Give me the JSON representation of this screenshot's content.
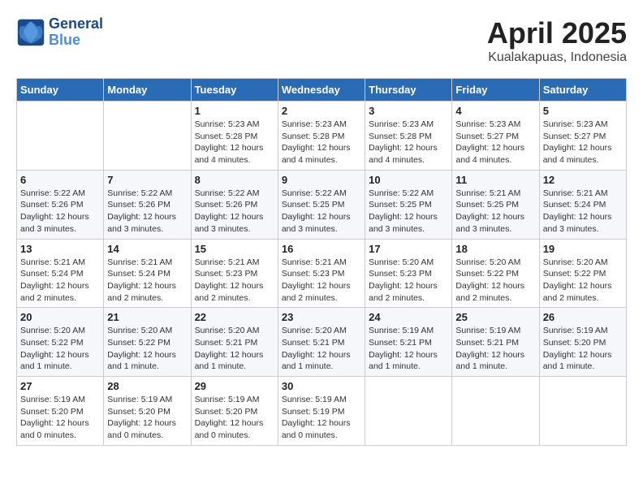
{
  "header": {
    "logo_line1": "General",
    "logo_line2": "Blue",
    "month_year": "April 2025",
    "location": "Kualakapuas, Indonesia"
  },
  "columns": [
    "Sunday",
    "Monday",
    "Tuesday",
    "Wednesday",
    "Thursday",
    "Friday",
    "Saturday"
  ],
  "weeks": [
    [
      {
        "day": "",
        "info": ""
      },
      {
        "day": "",
        "info": ""
      },
      {
        "day": "1",
        "info": "Sunrise: 5:23 AM\nSunset: 5:28 PM\nDaylight: 12 hours\nand 4 minutes."
      },
      {
        "day": "2",
        "info": "Sunrise: 5:23 AM\nSunset: 5:28 PM\nDaylight: 12 hours\nand 4 minutes."
      },
      {
        "day": "3",
        "info": "Sunrise: 5:23 AM\nSunset: 5:28 PM\nDaylight: 12 hours\nand 4 minutes."
      },
      {
        "day": "4",
        "info": "Sunrise: 5:23 AM\nSunset: 5:27 PM\nDaylight: 12 hours\nand 4 minutes."
      },
      {
        "day": "5",
        "info": "Sunrise: 5:23 AM\nSunset: 5:27 PM\nDaylight: 12 hours\nand 4 minutes."
      }
    ],
    [
      {
        "day": "6",
        "info": "Sunrise: 5:22 AM\nSunset: 5:26 PM\nDaylight: 12 hours\nand 3 minutes."
      },
      {
        "day": "7",
        "info": "Sunrise: 5:22 AM\nSunset: 5:26 PM\nDaylight: 12 hours\nand 3 minutes."
      },
      {
        "day": "8",
        "info": "Sunrise: 5:22 AM\nSunset: 5:26 PM\nDaylight: 12 hours\nand 3 minutes."
      },
      {
        "day": "9",
        "info": "Sunrise: 5:22 AM\nSunset: 5:25 PM\nDaylight: 12 hours\nand 3 minutes."
      },
      {
        "day": "10",
        "info": "Sunrise: 5:22 AM\nSunset: 5:25 PM\nDaylight: 12 hours\nand 3 minutes."
      },
      {
        "day": "11",
        "info": "Sunrise: 5:21 AM\nSunset: 5:25 PM\nDaylight: 12 hours\nand 3 minutes."
      },
      {
        "day": "12",
        "info": "Sunrise: 5:21 AM\nSunset: 5:24 PM\nDaylight: 12 hours\nand 3 minutes."
      }
    ],
    [
      {
        "day": "13",
        "info": "Sunrise: 5:21 AM\nSunset: 5:24 PM\nDaylight: 12 hours\nand 2 minutes."
      },
      {
        "day": "14",
        "info": "Sunrise: 5:21 AM\nSunset: 5:24 PM\nDaylight: 12 hours\nand 2 minutes."
      },
      {
        "day": "15",
        "info": "Sunrise: 5:21 AM\nSunset: 5:23 PM\nDaylight: 12 hours\nand 2 minutes."
      },
      {
        "day": "16",
        "info": "Sunrise: 5:21 AM\nSunset: 5:23 PM\nDaylight: 12 hours\nand 2 minutes."
      },
      {
        "day": "17",
        "info": "Sunrise: 5:20 AM\nSunset: 5:23 PM\nDaylight: 12 hours\nand 2 minutes."
      },
      {
        "day": "18",
        "info": "Sunrise: 5:20 AM\nSunset: 5:22 PM\nDaylight: 12 hours\nand 2 minutes."
      },
      {
        "day": "19",
        "info": "Sunrise: 5:20 AM\nSunset: 5:22 PM\nDaylight: 12 hours\nand 2 minutes."
      }
    ],
    [
      {
        "day": "20",
        "info": "Sunrise: 5:20 AM\nSunset: 5:22 PM\nDaylight: 12 hours\nand 1 minute."
      },
      {
        "day": "21",
        "info": "Sunrise: 5:20 AM\nSunset: 5:22 PM\nDaylight: 12 hours\nand 1 minute."
      },
      {
        "day": "22",
        "info": "Sunrise: 5:20 AM\nSunset: 5:21 PM\nDaylight: 12 hours\nand 1 minute."
      },
      {
        "day": "23",
        "info": "Sunrise: 5:20 AM\nSunset: 5:21 PM\nDaylight: 12 hours\nand 1 minute."
      },
      {
        "day": "24",
        "info": "Sunrise: 5:19 AM\nSunset: 5:21 PM\nDaylight: 12 hours\nand 1 minute."
      },
      {
        "day": "25",
        "info": "Sunrise: 5:19 AM\nSunset: 5:21 PM\nDaylight: 12 hours\nand 1 minute."
      },
      {
        "day": "26",
        "info": "Sunrise: 5:19 AM\nSunset: 5:20 PM\nDaylight: 12 hours\nand 1 minute."
      }
    ],
    [
      {
        "day": "27",
        "info": "Sunrise: 5:19 AM\nSunset: 5:20 PM\nDaylight: 12 hours\nand 0 minutes."
      },
      {
        "day": "28",
        "info": "Sunrise: 5:19 AM\nSunset: 5:20 PM\nDaylight: 12 hours\nand 0 minutes."
      },
      {
        "day": "29",
        "info": "Sunrise: 5:19 AM\nSunset: 5:20 PM\nDaylight: 12 hours\nand 0 minutes."
      },
      {
        "day": "30",
        "info": "Sunrise: 5:19 AM\nSunset: 5:19 PM\nDaylight: 12 hours\nand 0 minutes."
      },
      {
        "day": "",
        "info": ""
      },
      {
        "day": "",
        "info": ""
      },
      {
        "day": "",
        "info": ""
      }
    ]
  ]
}
